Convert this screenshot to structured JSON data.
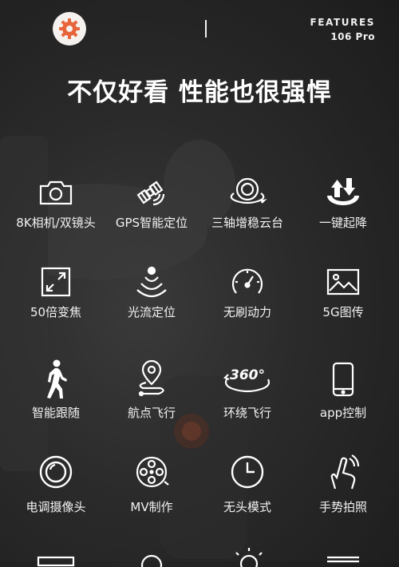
{
  "header": {
    "features_line1": "FEATURES",
    "features_line2": "106 Pro",
    "gear_icon": "gear-icon",
    "accent_color": "#e8643a"
  },
  "headline": "不仅好看 性能也很强悍",
  "features": [
    {
      "label": "8K相机/双镜头",
      "icon": "camera-icon"
    },
    {
      "label": "GPS智能定位",
      "icon": "satellite-icon"
    },
    {
      "label": "三轴增稳云台",
      "icon": "gimbal-icon"
    },
    {
      "label": "一键起降",
      "icon": "takeoff-landing-icon"
    },
    {
      "label": "50倍变焦",
      "icon": "zoom-icon"
    },
    {
      "label": "光流定位",
      "icon": "optical-flow-icon"
    },
    {
      "label": "无刷动力",
      "icon": "speedometer-icon"
    },
    {
      "label": "5G图传",
      "icon": "image-transmission-icon"
    },
    {
      "label": "智能跟随",
      "icon": "walking-person-icon"
    },
    {
      "label": "航点飞行",
      "icon": "waypoint-icon"
    },
    {
      "label": "环绕飞行",
      "icon": "orbit-360-icon"
    },
    {
      "label": "app控制",
      "icon": "phone-icon"
    },
    {
      "label": "电调摄像头",
      "icon": "lens-icon"
    },
    {
      "label": "MV制作",
      "icon": "film-reel-icon"
    },
    {
      "label": "无头模式",
      "icon": "clock-icon"
    },
    {
      "label": "手势拍照",
      "icon": "gesture-icon"
    }
  ]
}
